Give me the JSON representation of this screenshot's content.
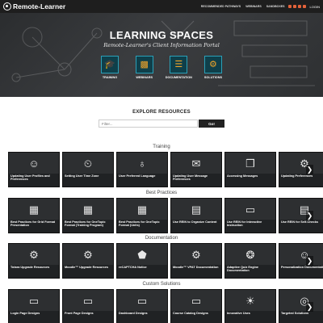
{
  "header": {
    "brand": "Remote-Learner",
    "nav": [
      "RECOMMENDED PATHWAYS",
      "WEBINARS",
      "SANDBOXES"
    ],
    "login": "LOGIN"
  },
  "hero": {
    "title": "LEARNING SPACES",
    "subtitle": "Remote-Learner's Client Information Portal",
    "quick_links": [
      {
        "label": "TRAINING",
        "icon": "cap-icon"
      },
      {
        "label": "WEBINARS",
        "icon": "presentation-icon"
      },
      {
        "label": "DOCUMENTATION",
        "icon": "document-icon"
      },
      {
        "label": "SOLUTIONS",
        "icon": "gears-icon"
      }
    ]
  },
  "explore": {
    "title": "EXPLORE RESOURCES",
    "filter_placeholder": "Filter...",
    "go_label": "Go!"
  },
  "sections": [
    {
      "title": "Training",
      "cards": [
        {
          "title": "Updating User Profiles and Preferences",
          "icon": "user-icon"
        },
        {
          "title": "Setting User Time Zone",
          "icon": "clock-icon"
        },
        {
          "title": "User Preferred Language",
          "icon": "globe-icon"
        },
        {
          "title": "Updating User Message Preferences",
          "icon": "envelope-icon"
        },
        {
          "title": "Accessing Messages",
          "icon": "chat-icon"
        },
        {
          "title": "Updating Preferences",
          "icon": "gear-icon"
        }
      ]
    },
    {
      "title": "Best Practices",
      "cards": [
        {
          "title": "Best Practices for Grid Format Presentation",
          "icon": "grid-icon"
        },
        {
          "title": "Best Practices for OneTopic Format (Training Program)",
          "icon": "grid-icon"
        },
        {
          "title": "Best Practices for OneTopic Format (Units)",
          "icon": "grid-icon"
        },
        {
          "title": "Use REIN to Organize Content",
          "icon": "book-icon"
        },
        {
          "title": "Use REIN for Interactive Instruction",
          "icon": "screen-icon"
        },
        {
          "title": "Use REIN for Self-Checks",
          "icon": "book-icon"
        }
      ]
    },
    {
      "title": "Documentation",
      "cards": [
        {
          "title": "Totara Upgrade Resources",
          "icon": "gears-icon"
        },
        {
          "title": "Moodle™ Upgrade Resources",
          "icon": "gears-icon"
        },
        {
          "title": "reCAPTCHA Notice",
          "icon": "shield-icon"
        },
        {
          "title": "Moodle™ VPAT Documentation",
          "icon": "gears-icon"
        },
        {
          "title": "Adaptive Quiz Engine Documentation",
          "icon": "network-icon"
        },
        {
          "title": "Personalization Documentation",
          "icon": "user-icon"
        }
      ]
    },
    {
      "title": "Custom Solutions",
      "cards": [
        {
          "title": "Login Page Designs",
          "icon": "screen-icon"
        },
        {
          "title": "Front Page Designs",
          "icon": "screen-icon"
        },
        {
          "title": "Dashboard Designs",
          "icon": "screen-icon"
        },
        {
          "title": "Course Catalog Designs",
          "icon": "screen-icon"
        },
        {
          "title": "Innovative Uses",
          "icon": "bulb-icon"
        },
        {
          "title": "Targeted Solutions",
          "icon": "target-icon"
        }
      ]
    }
  ],
  "colors": {
    "topbar": "#1e1e1e",
    "accent": "#f0a429",
    "social": "#e3623a",
    "icon_box": "#0f3f4a"
  }
}
